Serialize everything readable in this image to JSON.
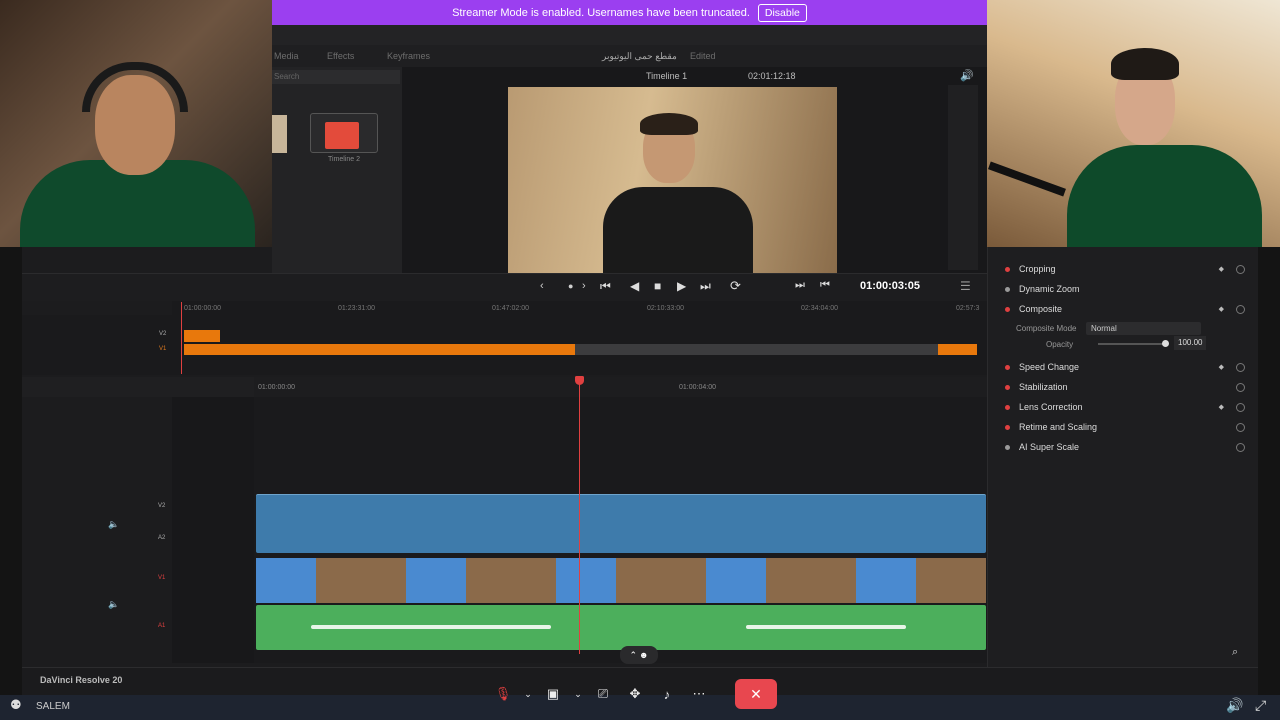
{
  "banner": {
    "message": "Streamer Mode is enabled. Usernames have been truncated.",
    "button": "Disable"
  },
  "resolve": {
    "app_name": "DaVinci Resolve 20",
    "menu_items": [
      "Media",
      "Effects",
      "Keyframes"
    ],
    "project_title": "مقطع حمى اليوتيوبر",
    "edited_label": "Edited",
    "mediapool": {
      "search_placeholder": "Search",
      "clip_name": "Timeline 2"
    },
    "viewer": {
      "timeline_name": "Timeline 1",
      "source_timecode": "02:01:12:18",
      "record_timecode": "01:00:03:05"
    },
    "upper_ruler": [
      "01:00:00:00",
      "01:23:31:00",
      "01:47:02:00",
      "02:10:33:00",
      "02:34:04:00",
      "02:57:3"
    ],
    "lower_ruler": [
      "01:00:00:00",
      "01:00:04:00"
    ],
    "tracks": {
      "upper": [
        "V2",
        "V1"
      ],
      "lower": [
        "V2",
        "A2",
        "V1",
        "A1"
      ]
    },
    "inspector": {
      "items": [
        {
          "label": "Cropping",
          "active": true
        },
        {
          "label": "Dynamic Zoom",
          "active": false
        },
        {
          "label": "Composite",
          "active": true
        },
        {
          "label": "Speed Change",
          "active": true
        },
        {
          "label": "Stabilization",
          "active": true
        },
        {
          "label": "Lens Correction",
          "active": true
        },
        {
          "label": "Retime and Scaling",
          "active": true
        },
        {
          "label": "AI Super Scale",
          "active": false
        }
      ],
      "composite_mode_label": "Composite Mode",
      "composite_mode_value": "Normal",
      "opacity_label": "Opacity",
      "opacity_value": "100.00"
    }
  },
  "call": {
    "participant_label": "SALEM"
  },
  "colors": {
    "banner": "#9b3ff0",
    "clip_blue": "#3e7bab",
    "clip_audio": "#4caf5c",
    "playhead": "#e04040",
    "leave": "#e8474f",
    "upper_clip": "#e8780c"
  }
}
